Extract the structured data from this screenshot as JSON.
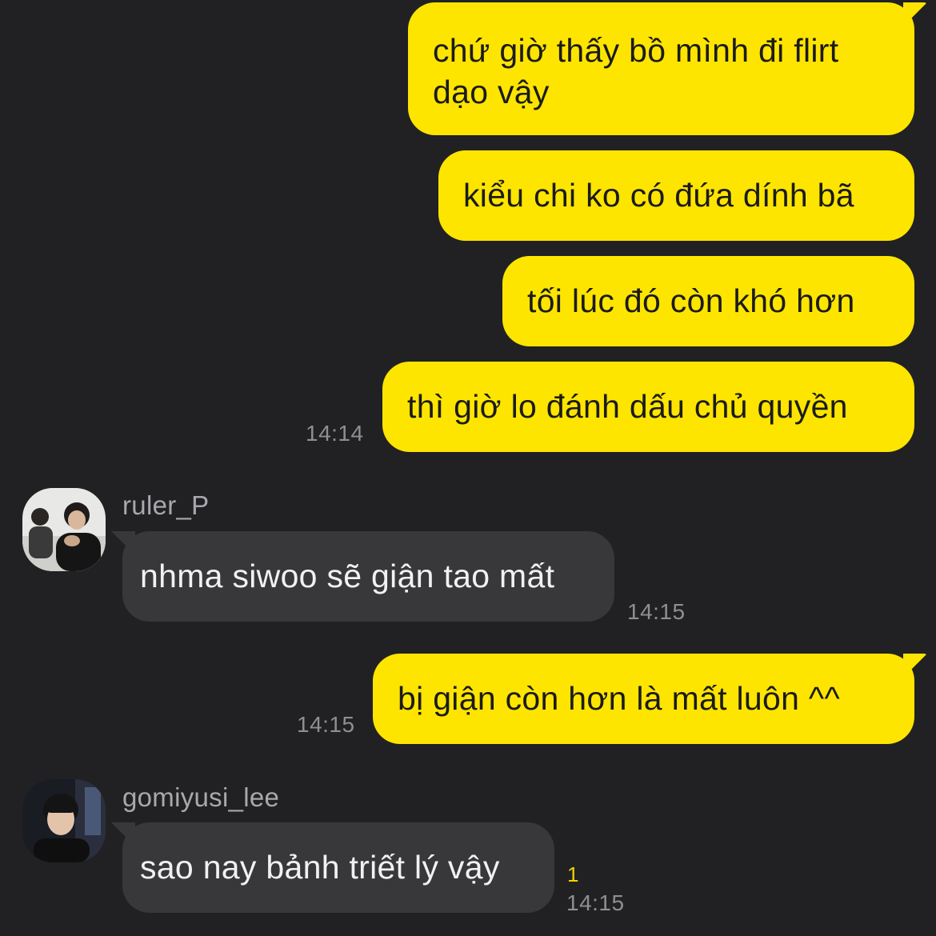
{
  "messages_out_1": {
    "line1": "chứ giờ thấy bồ mình đi flirt",
    "line2": "dạo vậy"
  },
  "messages_out_2": {
    "text": "kiểu chi ko có đứa dính bã"
  },
  "messages_out_3": {
    "text": "tối lúc đó còn khó hơn"
  },
  "messages_out_4": {
    "text": "thì giờ lo đánh dấu chủ quyền",
    "time": "14:14"
  },
  "messages_in_1": {
    "sender": "ruler_P",
    "text": "nhma siwoo sẽ giận tao mất",
    "time": "14:15",
    "avatar_icon": "profile-photo"
  },
  "messages_out_5": {
    "text": "bị giận còn hơn là mất luôn ^^",
    "time": "14:15"
  },
  "messages_in_2": {
    "sender": "gomiyusi_lee",
    "text": "sao nay bảnh triết lý vậy",
    "time": "14:15",
    "unread": "1",
    "avatar_icon": "profile-photo"
  },
  "colors": {
    "background": "#212123",
    "outgoing_bubble": "#FEE500",
    "incoming_bubble": "#38383b",
    "unread_count": "#f3d200"
  }
}
